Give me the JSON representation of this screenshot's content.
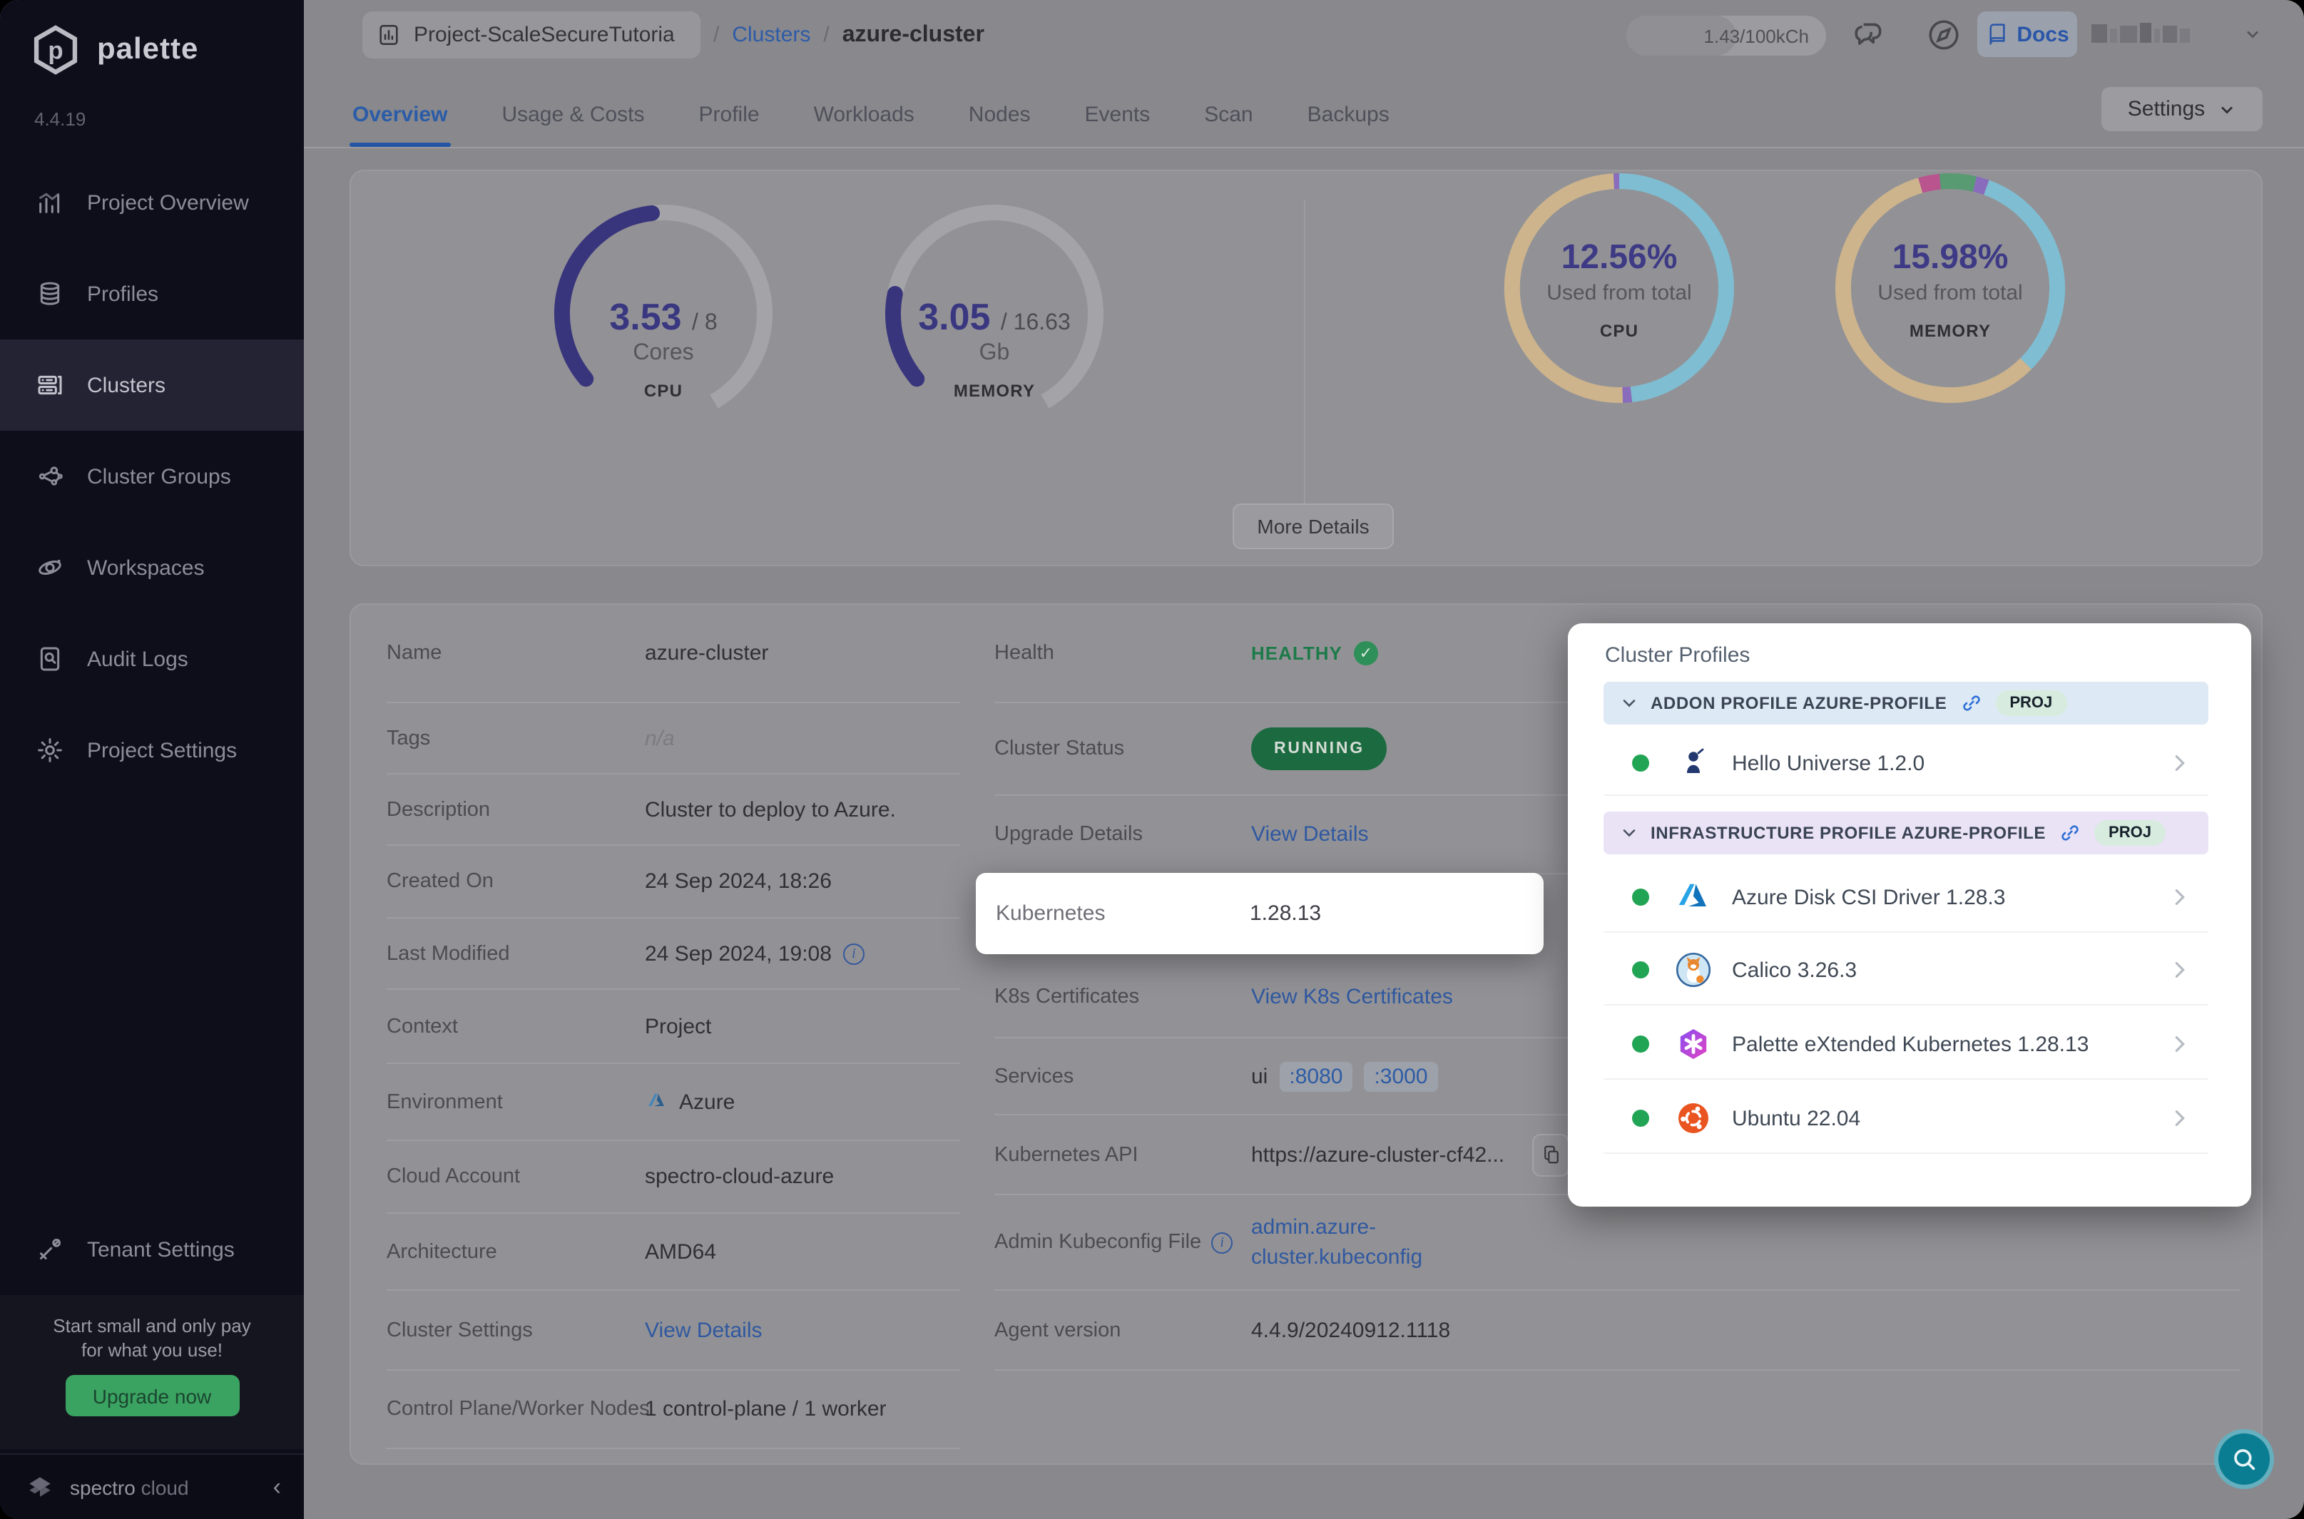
{
  "sidebar": {
    "brand": "palette",
    "version": "4.4.19",
    "items": [
      {
        "icon": "bar-chart",
        "label": "Project Overview",
        "active": false
      },
      {
        "icon": "layers",
        "label": "Profiles",
        "active": false
      },
      {
        "icon": "server",
        "label": "Clusters",
        "active": true
      },
      {
        "icon": "network",
        "label": "Cluster Groups",
        "active": false
      },
      {
        "icon": "orbit",
        "label": "Workspaces",
        "active": false
      },
      {
        "icon": "audit",
        "label": "Audit Logs",
        "active": false
      },
      {
        "icon": "gear",
        "label": "Project Settings",
        "active": false
      }
    ],
    "tenant_item": {
      "icon": "tools",
      "label": "Tenant Settings"
    },
    "promo_line1": "Start small and only pay",
    "promo_line2": "for what you use!",
    "upgrade_label": "Upgrade now",
    "footer_brand_1": "spectro",
    "footer_brand_2": "cloud"
  },
  "header": {
    "breadcrumb_project": "Project-ScaleSecureTutoria",
    "separator": "/",
    "breadcrumb_section": "Clusters",
    "breadcrumb_current": "azure-cluster",
    "usage_badge": "1.43/100kCh",
    "docs_label": "Docs"
  },
  "tabs": {
    "items": [
      "Overview",
      "Usage & Costs",
      "Profile",
      "Workloads",
      "Nodes",
      "Events",
      "Scan",
      "Backups"
    ],
    "active": "Overview",
    "settings_label": "Settings"
  },
  "overview": {
    "more_details_label": "More Details"
  },
  "chart_data": [
    {
      "type": "gauge",
      "id": "cpu",
      "value": 3.53,
      "max": 8,
      "value_display": "3.53",
      "max_display": "8",
      "unit": "Cores",
      "caption": "CPU",
      "arc_span_deg": 280,
      "track_color": "#a4a4a8",
      "value_color": "#39357c"
    },
    {
      "type": "gauge",
      "id": "memory",
      "value": 3.05,
      "max": 16.63,
      "value_display": "3.05",
      "max_display": "16.63",
      "unit": "Gb",
      "caption": "MEMORY",
      "arc_span_deg": 280,
      "track_color": "#a4a4a8",
      "value_color": "#39357c"
    },
    {
      "type": "donut",
      "id": "cpu-used",
      "percent": 12.56,
      "label": "12.56%",
      "sublabel": "Used from total",
      "caption": "CPU",
      "start_offset": 0,
      "segments": [
        {
          "color": "#7fbdd2",
          "fraction": 0.482
        },
        {
          "color": "#8a6cbd",
          "fraction": 0.013
        },
        {
          "color": "#cdb48c",
          "fraction": 0.497
        },
        {
          "color": "#8a6cbd",
          "fraction": 0.008
        }
      ]
    },
    {
      "type": "donut",
      "id": "memory-used",
      "percent": 15.98,
      "label": "15.98%",
      "sublabel": "Used from total",
      "caption": "MEMORY",
      "start_offset": -0.045,
      "segments": [
        {
          "color": "#b9548f",
          "fraction": 0.03
        },
        {
          "color": "#589a72",
          "fraction": 0.052
        },
        {
          "color": "#8a6cbd",
          "fraction": 0.018
        },
        {
          "color": "#7fbdd2",
          "fraction": 0.32
        },
        {
          "color": "#cdb48c",
          "fraction": 0.58
        }
      ]
    }
  ],
  "details_left": [
    {
      "label": "Name",
      "type": "text",
      "value": "azure-cluster"
    },
    {
      "label": "Tags",
      "type": "muted",
      "value": "n/a"
    },
    {
      "label": "Description",
      "type": "text",
      "value": "Cluster to deploy to Azure."
    },
    {
      "label": "Created On",
      "type": "text",
      "value": "24 Sep 2024, 18:26"
    },
    {
      "label": "Last Modified",
      "type": "text-info",
      "value": "24 Sep 2024, 19:08"
    },
    {
      "label": "Context",
      "type": "text",
      "value": "Project"
    },
    {
      "label": "Environment",
      "type": "azure",
      "value": "Azure"
    },
    {
      "label": "Cloud Account",
      "type": "text",
      "value": "spectro-cloud-azure"
    },
    {
      "label": "Architecture",
      "type": "text",
      "value": "AMD64"
    },
    {
      "label": "Cluster Settings",
      "type": "link",
      "value": "View Details"
    },
    {
      "label": "Control Plane/Worker Nodes",
      "type": "text",
      "value": "1 control-plane / 1 worker"
    }
  ],
  "details_right": [
    {
      "label": "Health",
      "type": "health",
      "value": "HEALTHY"
    },
    {
      "label": "Cluster Status",
      "type": "pill",
      "value": "RUNNING"
    },
    {
      "label": "Upgrade Details",
      "type": "link",
      "value": "View Details"
    },
    {
      "label": "",
      "type": "spacer",
      "value": ""
    },
    {
      "label": "K8s Certificates",
      "type": "link",
      "value": "View K8s Certificates"
    },
    {
      "label": "Services",
      "type": "services",
      "prefix": "ui",
      "ports": [
        ":8080",
        ":3000"
      ]
    },
    {
      "label": "Kubernetes API",
      "type": "api",
      "value": "https://azure-cluster-cf42...",
      "copy": true
    },
    {
      "label": "Admin Kubeconfig File",
      "type": "link2",
      "info": true,
      "lines": [
        "admin.azure-",
        "cluster.kubeconfig"
      ]
    },
    {
      "label": "Agent version",
      "type": "text",
      "value": "4.4.9/20240912.1118"
    }
  ],
  "kubernetes_highlight": {
    "label": "Kubernetes",
    "value": "1.28.13"
  },
  "cluster_profiles": {
    "title": "Cluster Profiles",
    "sections": [
      {
        "label": "ADDON PROFILE AZURE-PROFILE",
        "badge": "PROJ",
        "header_bg": "#dde9f4",
        "items": [
          {
            "icon": "hello-universe",
            "name": "Hello Universe 1.2.0"
          }
        ]
      },
      {
        "label": "INFRASTRUCTURE PROFILE AZURE-PROFILE",
        "badge": "PROJ",
        "header_bg": "#eae3f6",
        "items": [
          {
            "icon": "azure-disk",
            "name": "Azure Disk CSI Driver 1.28.3"
          },
          {
            "icon": "calico",
            "name": "Calico 3.26.3"
          },
          {
            "icon": "palette-k8s",
            "name": "Palette eXtended Kubernetes 1.28.13"
          },
          {
            "icon": "ubuntu",
            "name": "Ubuntu 22.04"
          }
        ]
      }
    ]
  },
  "colors": {
    "accent_blue": "#2b5ca8",
    "healthy_green": "#1d7a49",
    "running_green": "#1c6b40",
    "upgrade_green": "#3ba361",
    "fab_teal": "#0a7d92",
    "profile_dot_green": "#21a453",
    "gauge_indigo": "#39357c",
    "donut_tan": "#cdb48c",
    "donut_teal": "#7fbdd2",
    "donut_purple": "#8a6cbd",
    "donut_pink": "#b9548f",
    "donut_green": "#589a72"
  }
}
